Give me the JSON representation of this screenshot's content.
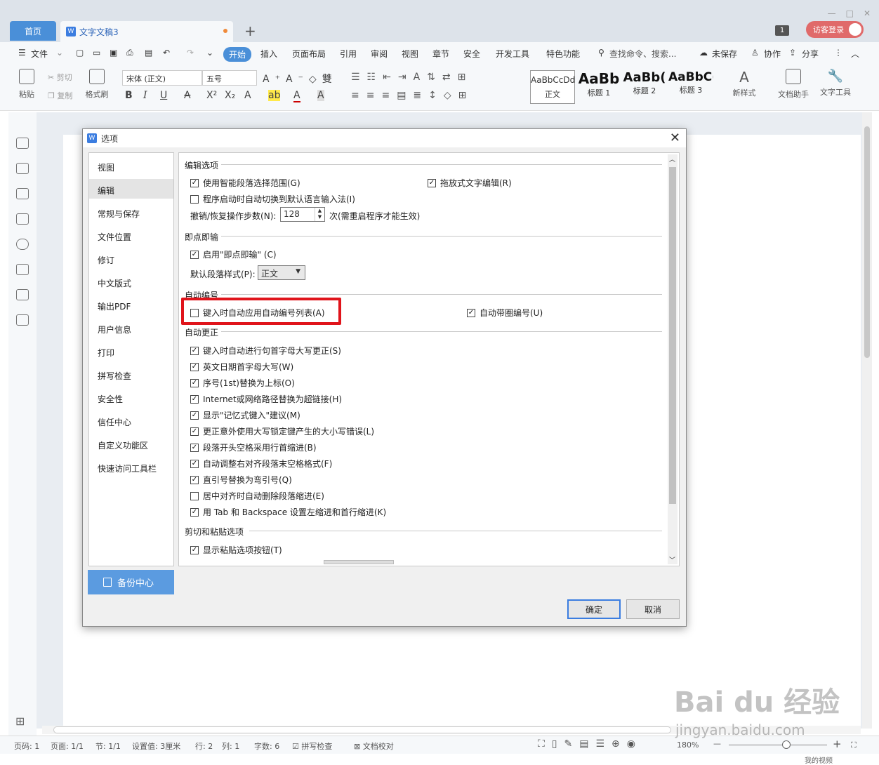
{
  "titlebar": {
    "home_tab": "首页",
    "doc_tab": "文字文稿3",
    "doc_icon": "W",
    "new_tab": "+",
    "badge": "1",
    "guest_login": "访客登录"
  },
  "menubar": {
    "file": "文件",
    "items": [
      "开始",
      "插入",
      "页面布局",
      "引用",
      "审阅",
      "视图",
      "章节",
      "安全",
      "开发工具",
      "特色功能"
    ],
    "search": "查找命令、搜索...",
    "unsaved": "未保存",
    "collab": "协作",
    "share": "分享"
  },
  "toolbar": {
    "paste": "粘贴",
    "cut": "剪切",
    "copy": "复制",
    "format_painter": "格式刷",
    "font_name": "宋体 (正文)",
    "font_size": "五号",
    "styles": [
      {
        "preview": "AaBbCcDd",
        "label": "正文"
      },
      {
        "preview": "AaBb",
        "label": "标题 1"
      },
      {
        "preview": "AaBb(",
        "label": "标题 2"
      },
      {
        "preview": "AaBbC(",
        "label": "标题 3"
      }
    ],
    "new_style": "新样式",
    "doc_helper": "文档助手",
    "text_tools": "文字工具"
  },
  "dialog": {
    "title": "选项",
    "logo": "W",
    "nav": [
      "视图",
      "编辑",
      "常规与保存",
      "文件位置",
      "修订",
      "中文版式",
      "输出PDF",
      "用户信息",
      "打印",
      "拼写检查",
      "安全性",
      "信任中心",
      "自定义功能区",
      "快速访问工具栏"
    ],
    "selected_nav": "编辑",
    "backup": "备份中心",
    "sections": {
      "edit": "编辑选项",
      "click_type": "即点即输",
      "autonumber": "自动编号",
      "autocorrect": "自动更正",
      "cutpaste": "剪切和粘贴选项"
    },
    "edit_opts": {
      "smart_select": "使用智能段落选择范围(G)",
      "drag_edit": "拖放式文字编辑(R)",
      "auto_ime": "程序启动时自动切换到默认语言输入法(I)",
      "undo_label": "撤销/恢复操作步数(N):",
      "undo_value": "128",
      "undo_note": "次(需重启程序才能生效)"
    },
    "click_type_opts": {
      "enable": "启用\"即点即输\" (C)",
      "default_style_label": "默认段落样式(P):",
      "default_style_value": "正文"
    },
    "autonumber_opts": {
      "auto_list": "键入时自动应用自动编号列表(A)",
      "circled": "自动带圈编号(U)"
    },
    "autocorrect_opts": [
      {
        "label": "键入时自动进行句首字母大写更正(S)",
        "checked": true
      },
      {
        "label": "英文日期首字母大写(W)",
        "checked": true
      },
      {
        "label": "序号(1st)替换为上标(O)",
        "checked": true
      },
      {
        "label": "Internet或网络路径替换为超链接(H)",
        "checked": true
      },
      {
        "label": "显示\"记忆式键入\"建议(M)",
        "checked": true
      },
      {
        "label": "更正意外使用大写锁定键产生的大小写错误(L)",
        "checked": true
      },
      {
        "label": "段落开头空格采用行首缩进(B)",
        "checked": true
      },
      {
        "label": "自动调整右对齐段落末空格格式(F)",
        "checked": true
      },
      {
        "label": "直引号替换为弯引号(Q)",
        "checked": true
      },
      {
        "label": "居中对齐时自动删除段落缩进(E)",
        "checked": false
      },
      {
        "label": "用 Tab 和 Backspace 设置左缩进和首行缩进(K)",
        "checked": true
      }
    ],
    "cutpaste_opts": {
      "show_paste_btn": "显示粘贴选项按钮(T)"
    },
    "ok": "确定",
    "cancel": "取消"
  },
  "statusbar": {
    "page_num": "页码: 1",
    "pages": "页面: 1/1",
    "section": "节: 1/1",
    "setting": "设置值: 3厘米",
    "row": "行: 2",
    "col": "列: 1",
    "words": "字数: 6",
    "spell": "拼写检查",
    "proof": "文档校对",
    "zoom": "180%",
    "my_video": "我的视频"
  },
  "watermark": {
    "brand": "Bai du 经验",
    "url": "jingyan.baidu.com"
  },
  "colors": {
    "accent": "#4a8fd8",
    "highlight": "#e0141b"
  }
}
